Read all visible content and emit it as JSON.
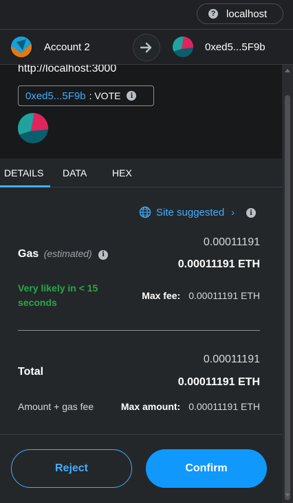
{
  "topbar": {
    "site": "localhost",
    "help_icon": "?"
  },
  "accounts": {
    "from_name": "Account 2",
    "to_name": "0xed5...5F9b",
    "arrow_icon": "arrow-right-icon"
  },
  "origin": {
    "url": "http://localhost:3000",
    "method_address": "0xed5...5F9b",
    "method_name": ": VOTE",
    "info_icon": "i"
  },
  "tabs": [
    "DETAILS",
    "DATA",
    "HEX"
  ],
  "details": {
    "site_suggested": "Site suggested",
    "chevron": "›",
    "gas_label": "Gas",
    "gas_estimated": "(estimated)",
    "gas_value": "0.00011191",
    "gas_value_eth": "0.00011191 ETH",
    "likely": "Very likely in < 15 seconds",
    "max_fee_label": "Max fee:",
    "max_fee_value": "0.00011191 ETH",
    "total_label": "Total",
    "total_value": "0.00011191",
    "total_value_eth": "0.00011191 ETH",
    "amount_gas_label": "Amount + gas fee",
    "max_amount_label": "Max amount:",
    "max_amount_value": "0.00011191 ETH"
  },
  "buttons": {
    "reject": "Reject",
    "confirm": "Confirm"
  },
  "colors": {
    "accent": "#43aefc",
    "confirm": "#1098fc",
    "success": "#28a745",
    "background": "#24272a"
  }
}
